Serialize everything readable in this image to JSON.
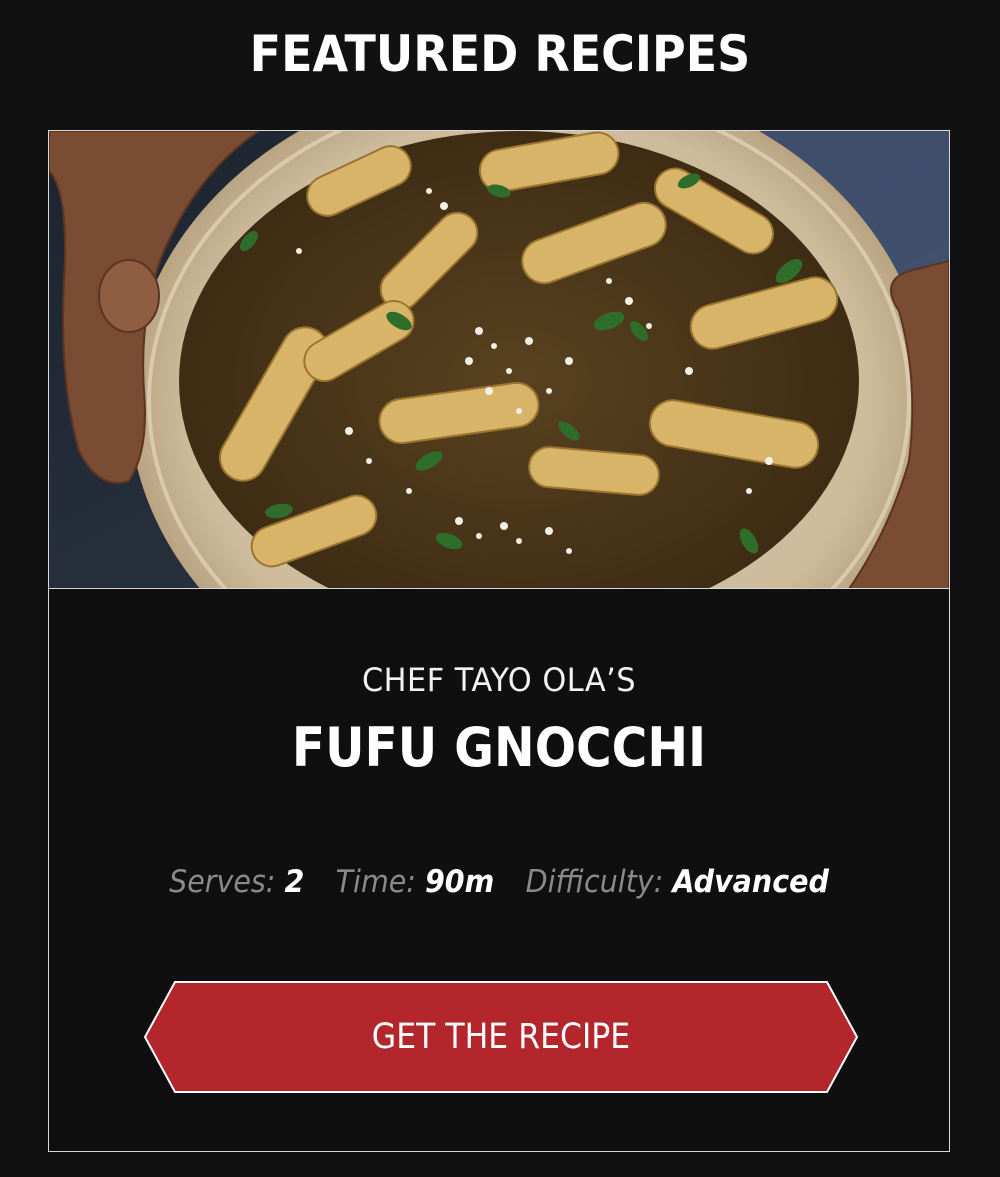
{
  "section": {
    "title": "FEATURED RECIPES"
  },
  "recipe": {
    "image_subject": "plate of fufu gnocchi with sauce, grated cheese and herbs held by two hands",
    "chef_line": "CHEF TAYO OLA’S",
    "title": "FUFU GNOCCHI",
    "serves_label": "Serves:",
    "serves_value": "2",
    "time_label": "Time:",
    "time_value": "90m",
    "difficulty_label": "Difficulty:",
    "difficulty_value": "Advanced",
    "cta_label": "GET THE RECIPE"
  },
  "colors": {
    "background": "#111111",
    "card_border": "#d9d9d9",
    "button_fill": "#b3262c",
    "meta_label": "#8a8a8a"
  }
}
